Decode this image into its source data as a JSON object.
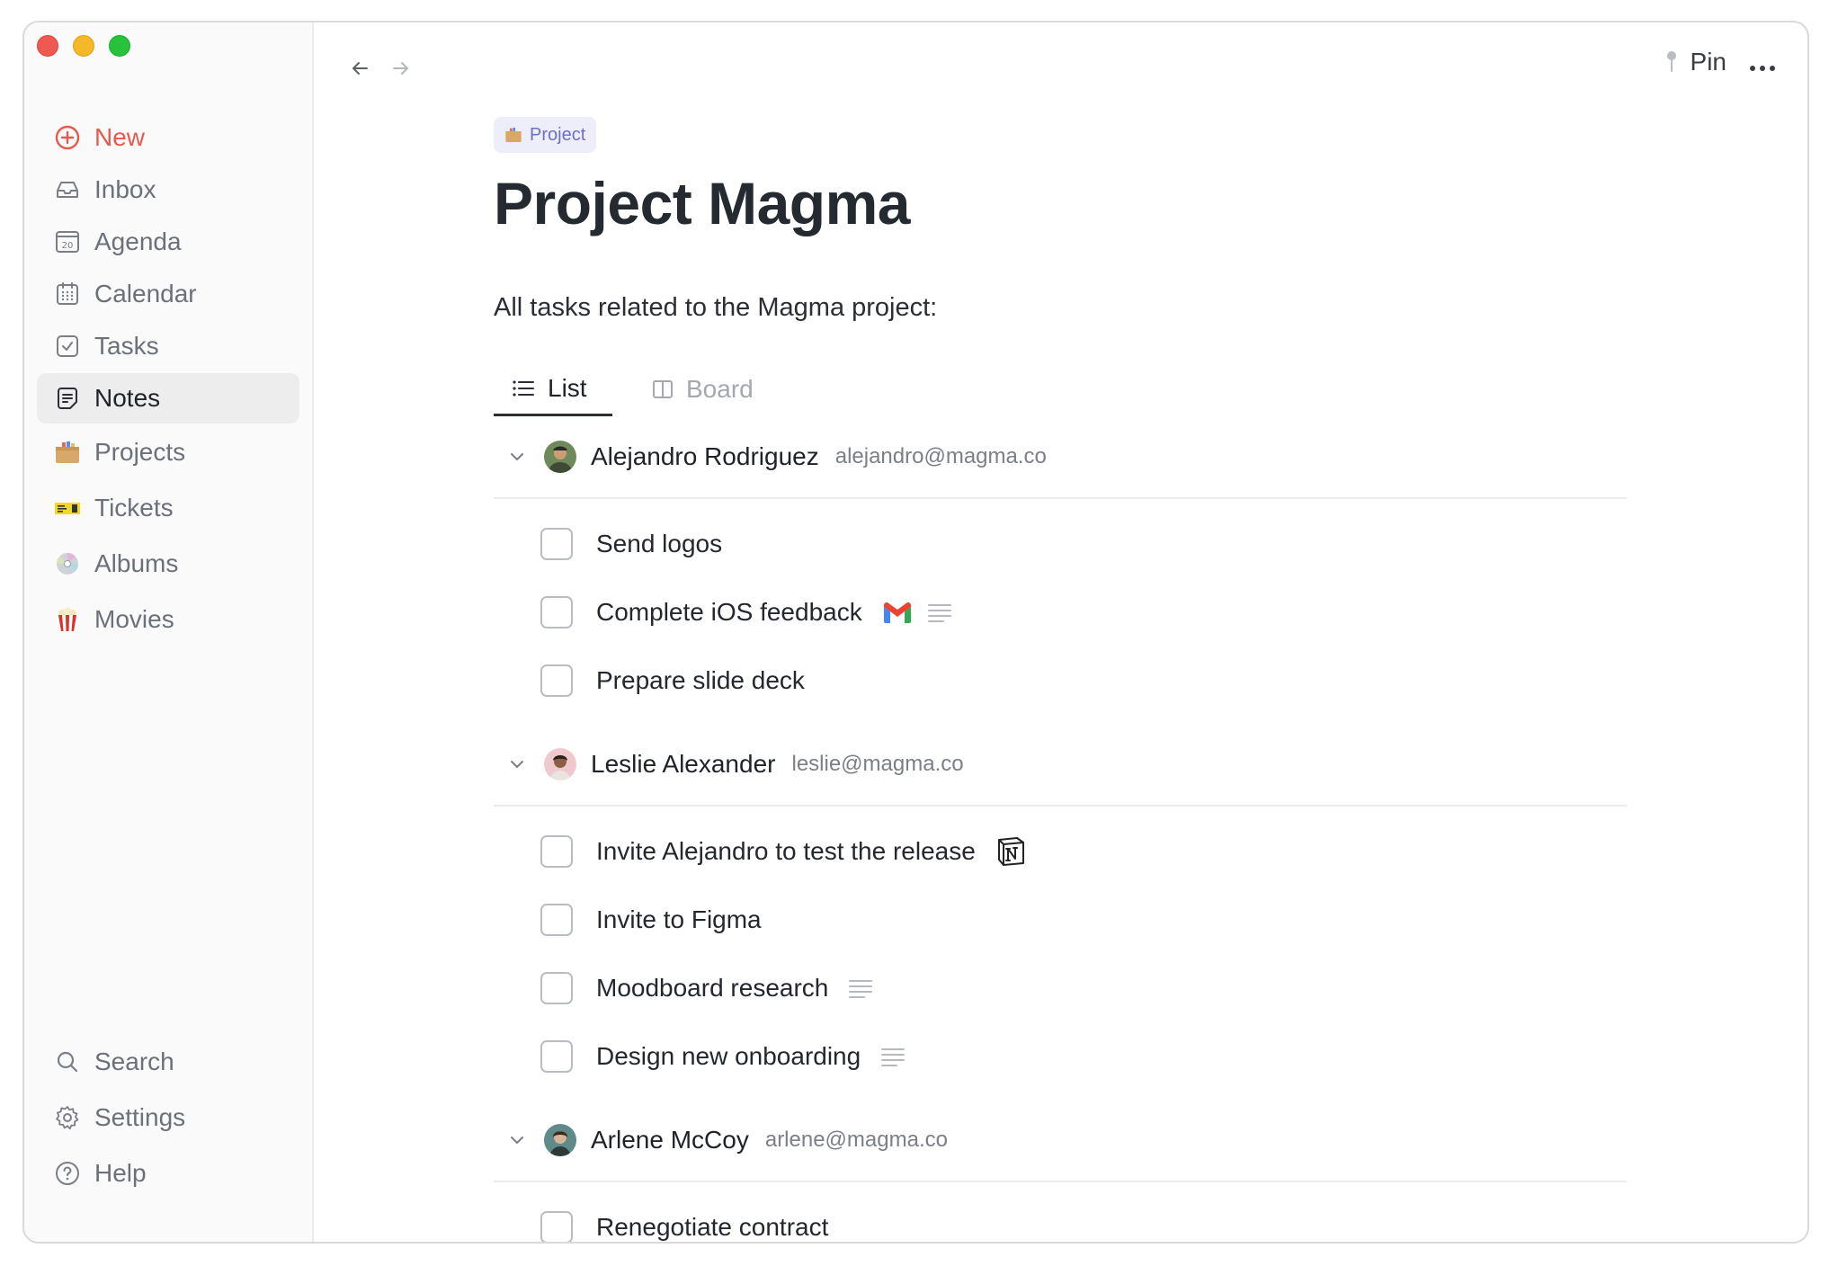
{
  "sidebar": {
    "items": [
      {
        "label": "New",
        "icon": "plus-circle-icon"
      },
      {
        "label": "Inbox",
        "icon": "inbox-icon"
      },
      {
        "label": "Agenda",
        "icon": "calendar-day-icon",
        "icon_text": "20"
      },
      {
        "label": "Calendar",
        "icon": "calendar-icon"
      },
      {
        "label": "Tasks",
        "icon": "checkbox-icon"
      },
      {
        "label": "Notes",
        "icon": "note-icon",
        "active": true
      },
      {
        "label": "Projects",
        "icon": "folder-icon"
      },
      {
        "label": "Tickets",
        "icon": "ticket-icon"
      },
      {
        "label": "Albums",
        "icon": "cd-icon"
      },
      {
        "label": "Movies",
        "icon": "popcorn-icon"
      }
    ],
    "bottom": [
      {
        "label": "Search",
        "icon": "search-icon"
      },
      {
        "label": "Settings",
        "icon": "gear-icon"
      },
      {
        "label": "Help",
        "icon": "help-icon"
      }
    ]
  },
  "topbar": {
    "pin_label": "Pin"
  },
  "page": {
    "tag": "Project",
    "title": "Project Magma",
    "description": "All tasks related to the Magma project:",
    "tabs": [
      {
        "label": "List",
        "active": true
      },
      {
        "label": "Board",
        "active": false
      }
    ]
  },
  "groups": [
    {
      "name": "Alejandro Rodriguez",
      "email": "alejandro@magma.co",
      "tasks": [
        {
          "label": "Send logos"
        },
        {
          "label": "Complete iOS feedback",
          "icons": [
            "gmail-icon",
            "notes-lines-icon"
          ]
        },
        {
          "label": "Prepare slide deck"
        }
      ]
    },
    {
      "name": "Leslie Alexander",
      "email": "leslie@magma.co",
      "tasks": [
        {
          "label": "Invite Alejandro to test the release",
          "icons": [
            "notion-icon"
          ]
        },
        {
          "label": "Invite to Figma"
        },
        {
          "label": "Moodboard research",
          "icons": [
            "notes-lines-icon"
          ]
        },
        {
          "label": "Design new onboarding",
          "icons": [
            "notes-lines-icon"
          ]
        }
      ]
    },
    {
      "name": "Arlene McCoy",
      "email": "arlene@magma.co",
      "tasks": [
        {
          "label": "Renegotiate contract"
        }
      ]
    }
  ],
  "colors": {
    "accent_new": "#e65a4e",
    "tag_bg": "#eeeefb",
    "tag_text": "#6b6fc7"
  }
}
